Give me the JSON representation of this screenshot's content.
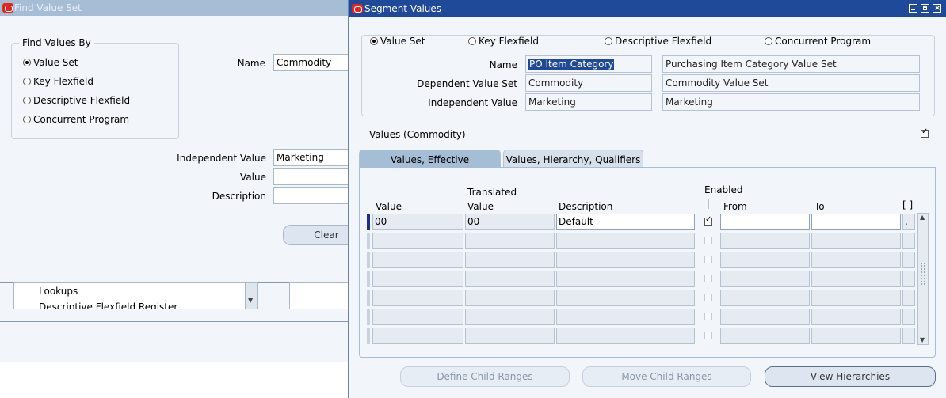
{
  "find_window": {
    "title": "Find Value Set",
    "find_values_by_label": "Find Values By",
    "radio_options": [
      {
        "label": "Value Set",
        "selected": true
      },
      {
        "label": "Key Flexfield",
        "selected": false
      },
      {
        "label": "Descriptive Flexfield",
        "selected": false
      },
      {
        "label": "Concurrent Program",
        "selected": false
      }
    ],
    "name_label": "Name",
    "name_value": "Commodity",
    "independent_value_label": "Independent Value",
    "independent_value": "Marketing",
    "value_label": "Value",
    "value_value": "",
    "description_label": "Description",
    "description_value": "",
    "clear_button": "Clear",
    "list_items": [
      "Lookups",
      "Descriptive Flexfield Register"
    ]
  },
  "segment_window": {
    "title": "Segment Values",
    "radio_options": [
      {
        "label": "Value Set",
        "selected": true
      },
      {
        "label": "Key Flexfield",
        "selected": false
      },
      {
        "label": "Descriptive Flexfield",
        "selected": false
      },
      {
        "label": "Concurrent Program",
        "selected": false
      }
    ],
    "name_label": "Name",
    "name_value": "PO Item Category",
    "name_description": "Purchasing Item Category Value Set",
    "dependent_label": "Dependent Value Set",
    "dependent_value": "Commodity",
    "dependent_description": "Commodity Value Set",
    "independent_label": "Independent Value",
    "independent_value": "Marketing",
    "independent_description": "Marketing",
    "values_section_label": "Values (Commodity)",
    "tabs": [
      {
        "label": "Values, Effective",
        "active": true
      },
      {
        "label": "Values, Hierarchy, Qualifiers",
        "active": false
      }
    ],
    "columns": {
      "value": "Value",
      "translated_line1": "Translated",
      "translated_line2": "Value",
      "description": "Description",
      "enabled": "Enabled",
      "from": "From",
      "to": "To",
      "brackets": "[ ]"
    },
    "rows": [
      {
        "value": "00",
        "translated": "00",
        "description": "Default",
        "enabled": true,
        "from": "",
        "to": "",
        "dff": "."
      },
      {
        "value": "",
        "translated": "",
        "description": "",
        "enabled": false,
        "from": "",
        "to": "",
        "dff": ""
      },
      {
        "value": "",
        "translated": "",
        "description": "",
        "enabled": false,
        "from": "",
        "to": "",
        "dff": ""
      },
      {
        "value": "",
        "translated": "",
        "description": "",
        "enabled": false,
        "from": "",
        "to": "",
        "dff": ""
      },
      {
        "value": "",
        "translated": "",
        "description": "",
        "enabled": false,
        "from": "",
        "to": "",
        "dff": ""
      },
      {
        "value": "",
        "translated": "",
        "description": "",
        "enabled": false,
        "from": "",
        "to": "",
        "dff": ""
      },
      {
        "value": "",
        "translated": "",
        "description": "",
        "enabled": false,
        "from": "",
        "to": "",
        "dff": ""
      }
    ],
    "buttons": {
      "define_child_ranges": "Define Child Ranges",
      "move_child_ranges": "Move Child Ranges",
      "view_hierarchies": "View Hierarchies"
    }
  },
  "colors": {
    "active_title": "#1e4a99",
    "inactive_title": "#a6bdd6",
    "window_bg": "#f2f5f9",
    "oracle_red": "#e3241b"
  }
}
